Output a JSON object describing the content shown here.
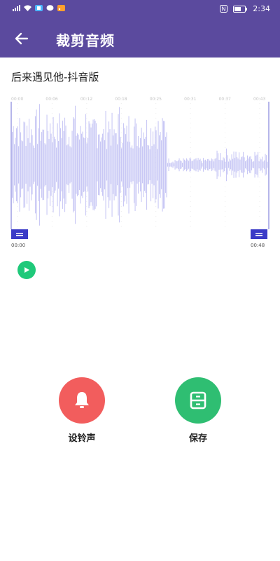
{
  "status_bar": {
    "time": "2:34",
    "left_icons": [
      "signal-icon",
      "wifi-icon",
      "app-notification-icon",
      "chat-notification-icon",
      "rss-notification-icon"
    ],
    "right_icons": [
      "nfc-icon",
      "battery-icon"
    ]
  },
  "app_bar": {
    "title": "裁剪音频",
    "back_icon": "arrow-left-icon"
  },
  "song": {
    "title": "后来遇见他-抖音版"
  },
  "waveform": {
    "time_ticks": [
      "00:00",
      "00:06",
      "00:12",
      "00:18",
      "00:25",
      "00:31",
      "00:37",
      "00:43"
    ],
    "start_time": "00:00",
    "end_time": "00:48",
    "wave_color": "#c9c8f5",
    "handle_color": "#3b3bc7"
  },
  "play": {
    "icon": "play-icon",
    "color": "#1fc97a"
  },
  "actions": [
    {
      "label": "设铃声",
      "icon": "bell-icon",
      "color": "#f25d5d"
    },
    {
      "label": "保存",
      "icon": "save-icon",
      "color": "#2fbe72"
    }
  ]
}
